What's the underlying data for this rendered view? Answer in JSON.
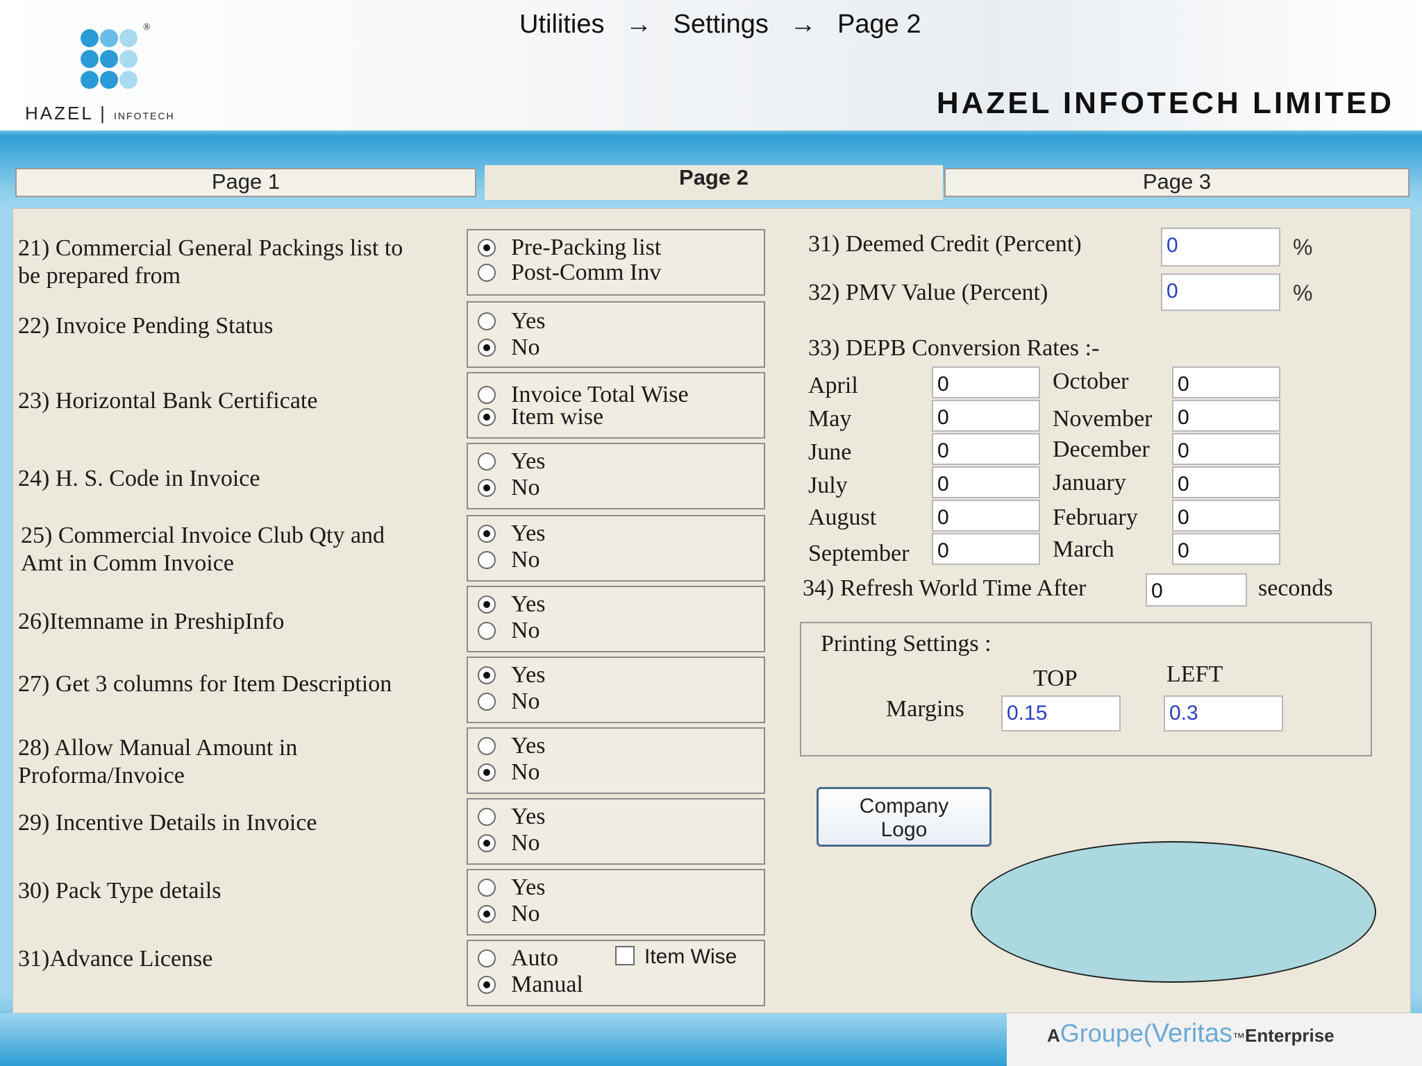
{
  "breadcrumb": {
    "item1": "Utilities",
    "item2": "Settings",
    "item3": "Page 2",
    "separator": "→"
  },
  "brand": {
    "logo_text": "HAZEL",
    "logo_sub": "INFOTECH",
    "registered": "®",
    "company": "HAZEL INFOTECH LIMITED"
  },
  "tabs": {
    "page1": "Page 1",
    "page2": "Page 2",
    "page3": "Page 3"
  },
  "left": {
    "q21": {
      "label_line1": "21) Commercial General Packings list to",
      "label_line2": "be prepared from",
      "opt1": "Pre-Packing list",
      "opt2": "Post-Comm Inv",
      "selected": 1
    },
    "q22": {
      "label": "22) Invoice Pending Status",
      "opt1": "Yes",
      "opt2": "No",
      "selected": 2
    },
    "q23": {
      "label": "23) Horizontal Bank Certificate",
      "opt1": "Invoice Total Wise",
      "opt2": "Item wise",
      "selected": 2
    },
    "q24": {
      "label": "24) H. S. Code in Invoice",
      "opt1": "Yes",
      "opt2": "No",
      "selected": 2
    },
    "q25": {
      "label_line1": "25) Commercial Invoice Club Qty and",
      "label_line2": "Amt in  Comm Invoice",
      "opt1": "Yes",
      "opt2": "No",
      "selected": 1
    },
    "q26": {
      "label": "26)Itemname in PreshipInfo",
      "opt1": "Yes",
      "opt2": "No",
      "selected": 1
    },
    "q27": {
      "label": "27) Get 3 columns for Item Description",
      "opt1": "Yes",
      "opt2": "No",
      "selected": 1
    },
    "q28": {
      "label_line1": "28) Allow Manual Amount in",
      "label_line2": "Proforma/Invoice",
      "opt1": "Yes",
      "opt2": "No",
      "selected": 2
    },
    "q29": {
      "label": "29) Incentive Details in Invoice",
      "opt1": "Yes",
      "opt2": "No",
      "selected": 2
    },
    "q30": {
      "label": "30) Pack Type details",
      "opt1": "Yes",
      "opt2": "No",
      "selected": 2
    },
    "q31": {
      "label": "31)Advance License",
      "opt1": "Auto",
      "opt2": "Manual",
      "selected": 2,
      "checkbox_label": "Item Wise",
      "checkbox_checked": false
    }
  },
  "right": {
    "deemed_credit": {
      "label": "31) Deemed Credit (Percent)",
      "value": "0",
      "unit": "%"
    },
    "pmv_value": {
      "label": "32) PMV Value (Percent)",
      "value": "0",
      "unit": "%"
    },
    "depb": {
      "label": "33) DEPB Conversion Rates :-",
      "months": [
        {
          "name": "April",
          "value": "0"
        },
        {
          "name": "May",
          "value": "0"
        },
        {
          "name": "June",
          "value": "0"
        },
        {
          "name": "July",
          "value": "0"
        },
        {
          "name": "August",
          "value": "0"
        },
        {
          "name": "September",
          "value": "0"
        },
        {
          "name": "October",
          "value": "0"
        },
        {
          "name": "November",
          "value": "0"
        },
        {
          "name": "December",
          "value": "0"
        },
        {
          "name": "January",
          "value": "0"
        },
        {
          "name": "February",
          "value": "0"
        },
        {
          "name": "March",
          "value": "0"
        }
      ]
    },
    "refresh": {
      "label": "34) Refresh World Time After",
      "value": "0",
      "unit": "seconds"
    },
    "printing": {
      "title": "Printing Settings :",
      "top_label": "TOP",
      "left_label": "LEFT",
      "margins_label": "Margins",
      "top_value": "0.15",
      "left_value": "0.3"
    },
    "logo_button": {
      "line1": "Company",
      "line2": "Logo"
    }
  },
  "footer": {
    "prefix": "A",
    "groupe": "Groupe",
    "veritas": "Veritas",
    "tm": "™",
    "enterprise": "Enterprise"
  },
  "colors": {
    "band": "#9fd6ee",
    "panel": "#ede8dc",
    "ellipse": "#acd9df",
    "input_text_blue": "#2a3fc0"
  }
}
